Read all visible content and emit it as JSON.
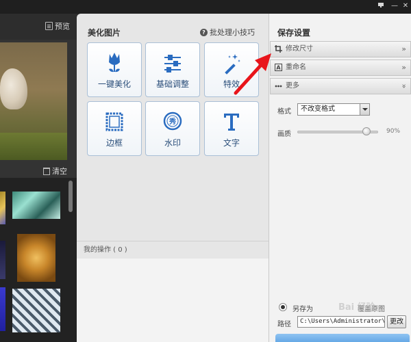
{
  "app": {
    "menu_icon": "menu-icon",
    "minimize_glyph": "—",
    "close_glyph": "✕"
  },
  "left": {
    "preview_label": "预览",
    "clear_label": "清空"
  },
  "center": {
    "title": "美化图片",
    "tips_label": "批处理小技巧",
    "tools": [
      {
        "label": "一键美化",
        "icon": "tulip-icon"
      },
      {
        "label": "基础调整",
        "icon": "sliders-icon"
      },
      {
        "label": "特效",
        "icon": "magic-wand-icon"
      },
      {
        "label": "边框",
        "icon": "frame-icon"
      },
      {
        "label": "水印",
        "icon": "watermark-stamp-icon"
      },
      {
        "label": "文字",
        "icon": "text-t-icon"
      }
    ],
    "ops_label": "我的操作 ( 0 )"
  },
  "right": {
    "title": "保存设置",
    "sections": [
      {
        "label": "修改尺寸",
        "icon": "crop-icon",
        "chevron": "»"
      },
      {
        "label": "重命名",
        "icon": "rename-icon",
        "chevron": "»"
      },
      {
        "label": "更多",
        "icon": "more-dots-icon",
        "chevron": "»"
      }
    ],
    "format_label": "格式",
    "format_value": "不改变格式",
    "quality_label": "画质",
    "quality_value": "90%",
    "quality_level": 0.9,
    "save_as_label": "另存为",
    "overwrite_label": "覆盖原图",
    "path_label": "路径",
    "path_value": "C:\\Users\\Administrator\\Do",
    "change_label": "更改"
  },
  "overlay": {
    "watermark_text": "Bai 经验",
    "arrow_color": "#e8151b"
  },
  "colors": {
    "accent_blue": "#2a4e7a",
    "tool_border": "#a9bfd6",
    "tool_icon": "#2a6cc0"
  }
}
